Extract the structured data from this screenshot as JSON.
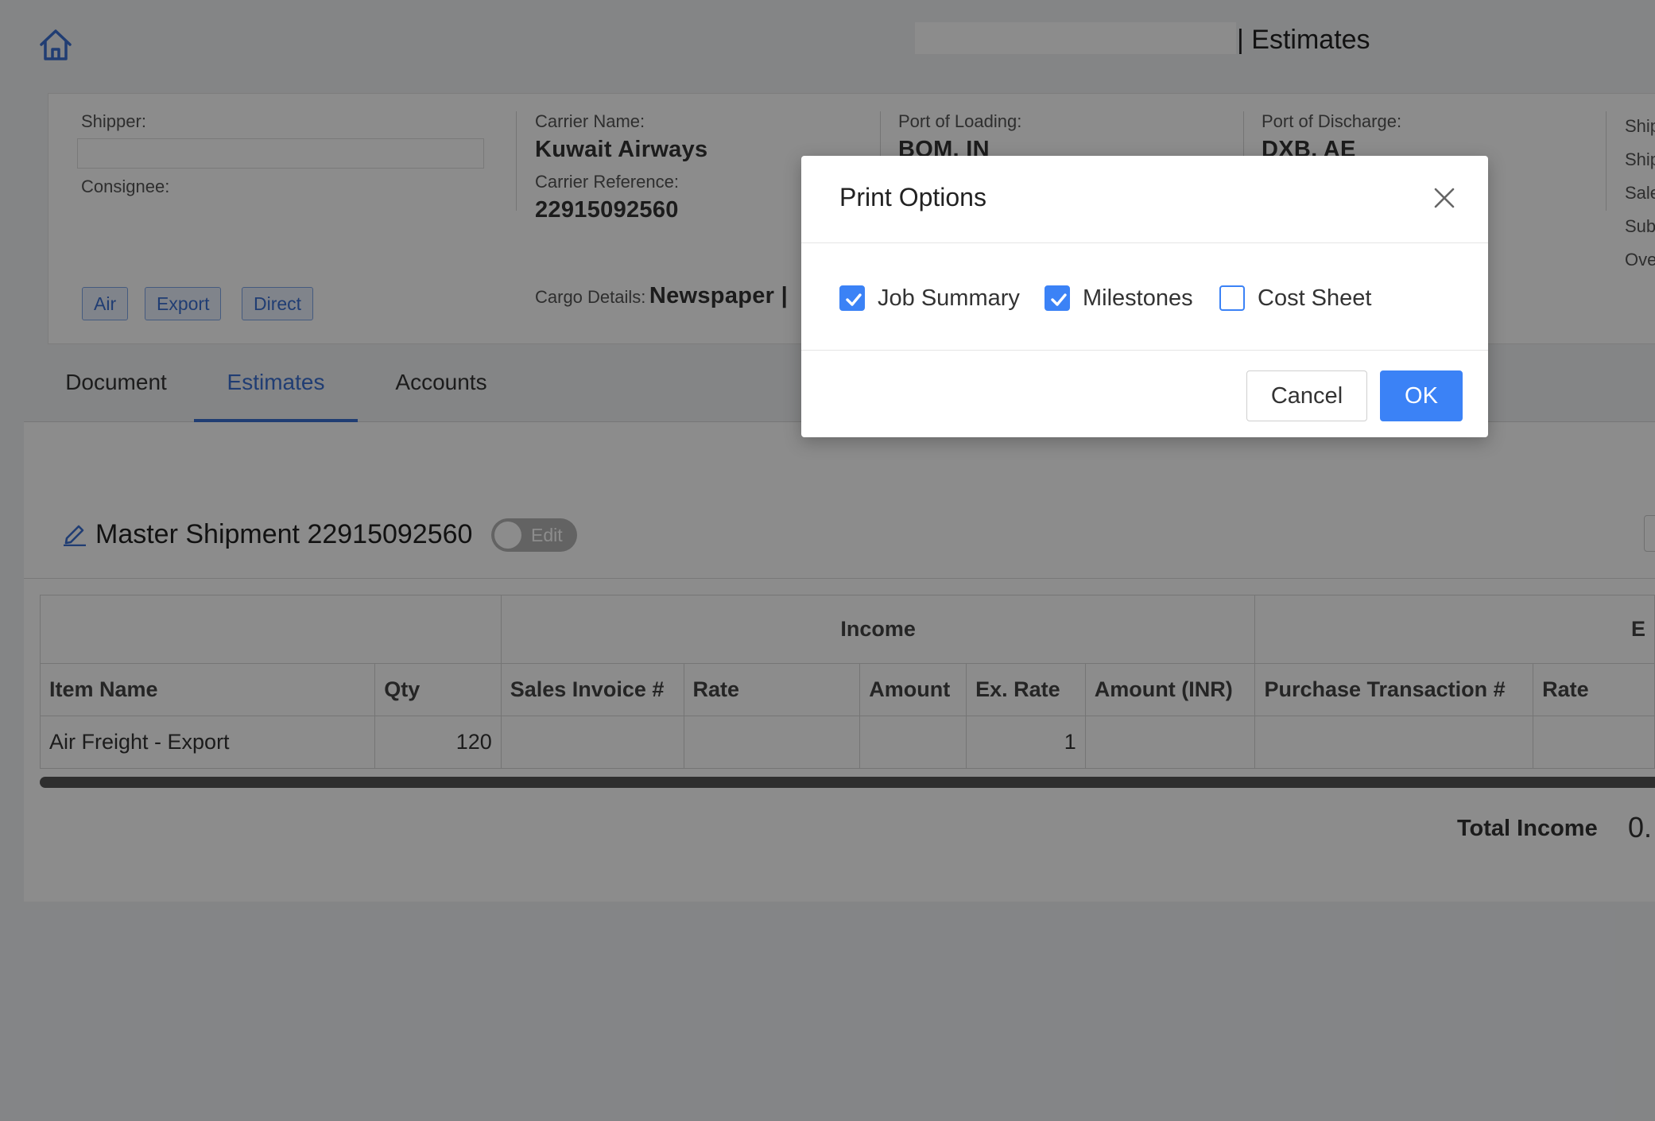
{
  "header": {
    "title": "| Estimates"
  },
  "info": {
    "shipper_label": "Shipper:",
    "consignee_label": "Consignee:",
    "carrier_name_label": "Carrier Name:",
    "carrier_name": "Kuwait Airways",
    "carrier_reference_label": "Carrier Reference:",
    "carrier_reference": "22915092560",
    "cargo_details_label": "Cargo Details:",
    "cargo_details": "Newspaper |",
    "port_loading_label": "Port of Loading:",
    "port_loading": "BOM, IN",
    "port_discharge_label": "Port of Discharge:",
    "port_discharge": "DXB, AE",
    "right_labels": [
      "Ship",
      "Ship",
      "Sale",
      "Sub",
      "Ove"
    ],
    "tags": [
      "Air",
      "Export",
      "Direct"
    ]
  },
  "tabs": [
    "Document",
    "Estimates",
    "Accounts"
  ],
  "active_tab": "Estimates",
  "shipment": {
    "title": "Master Shipment 22915092560",
    "toggle_label": "Edit"
  },
  "table": {
    "group_income": "Income",
    "group_expense": "E",
    "columns": [
      "Item Name",
      "Qty",
      "Sales Invoice #",
      "Rate",
      "Amount",
      "Ex. Rate",
      "Amount (INR)",
      "Purchase Transaction #",
      "Rate"
    ],
    "rows": [
      [
        "Air Freight - Export",
        "120",
        "",
        "",
        "",
        "1",
        "",
        "",
        ""
      ]
    ]
  },
  "totals": {
    "total_income_label": "Total Income",
    "total_income_value": "0."
  },
  "modal": {
    "title": "Print Options",
    "options": [
      {
        "label": "Job Summary",
        "checked": true
      },
      {
        "label": "Milestones",
        "checked": true
      },
      {
        "label": "Cost Sheet",
        "checked": false
      }
    ],
    "cancel_label": "Cancel",
    "ok_label": "OK"
  },
  "colors": {
    "accent": "#3b82f6",
    "tab_active": "#3b6fd1",
    "overlay": "rgba(0,0,0,0.45)"
  }
}
